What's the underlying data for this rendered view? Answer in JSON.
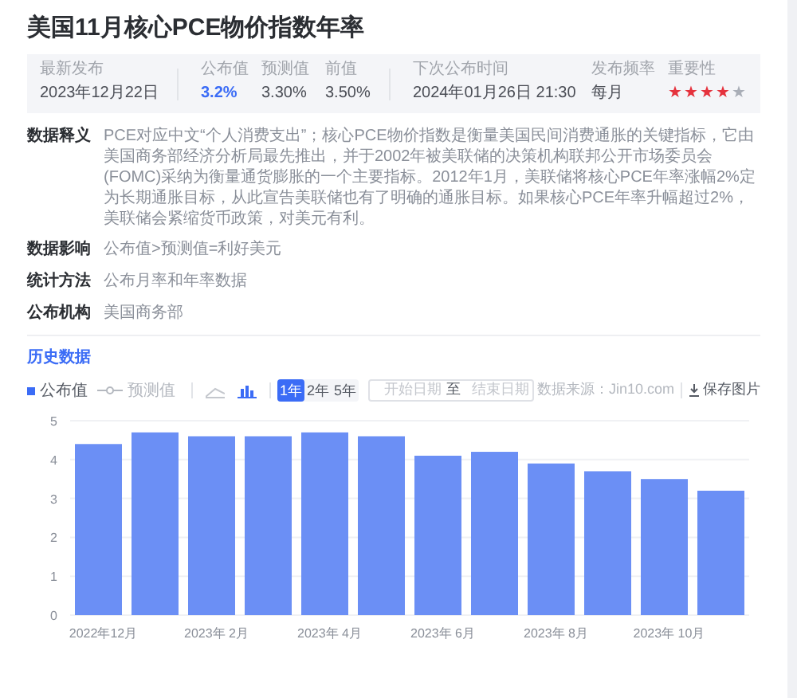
{
  "title": "美国11月核心PCE物价指数年率",
  "summary": [
    {
      "label": "最新发布",
      "value": "2023年12月22日",
      "kind": "text",
      "highlight": false
    },
    {
      "label": "公布值",
      "value": "3.2%",
      "kind": "text",
      "highlight": true
    },
    {
      "label": "预测值",
      "value": "3.30%",
      "kind": "text",
      "highlight": false
    },
    {
      "label": "前值",
      "value": "3.50%",
      "kind": "text",
      "highlight": false
    },
    {
      "label": "下次公布时间",
      "value": "2024年01月26日 21:30",
      "kind": "text",
      "highlight": false
    },
    {
      "label": "发布频率",
      "value": "每月",
      "kind": "text",
      "highlight": false
    },
    {
      "label": "重要性",
      "stars": 4,
      "kind": "stars"
    }
  ],
  "details": [
    {
      "label": "数据释义",
      "text": "PCE对应中文“个人消费支出”；核心PCE物价指数是衡量美国民间消费通胀的关键指标，它由美国商务部经济分析局最先推出，并于2002年被美联储的决策机构联邦公开市场委员会(FOMC)采纳为衡量通货膨胀的一个主要指标。2012年1月，美联储将核心PCE年率涨幅2%定为长期通胀目标，从此宣告美联储也有了明确的通胀目标。如果核心PCE年率升幅超过2%，美联储会紧缩货币政策，对美元有利。"
    },
    {
      "label": "数据影响",
      "text": "公布值>预测值=利好美元"
    },
    {
      "label": "统计方法",
      "text": "公布月率和年率数据"
    },
    {
      "label": "公布机构",
      "text": "美国商务部"
    }
  ],
  "history": {
    "title": "历史数据",
    "legend": [
      {
        "label": "公布值",
        "kind": "square",
        "selected": true
      },
      {
        "label": "预测值",
        "kind": "line",
        "selected": false
      }
    ],
    "chart_types": [
      {
        "kind": "line",
        "selected": false
      },
      {
        "kind": "bar",
        "selected": true
      }
    ],
    "ranges": [
      {
        "label": "1年",
        "selected": true
      },
      {
        "label": "2年",
        "selected": false
      },
      {
        "label": "5年",
        "selected": false
      }
    ],
    "start_placeholder": "开始日期",
    "separator": "至",
    "end_placeholder": "结束日期",
    "source": "数据来源：Jin10.com",
    "save": "保存图片",
    "chart_data": {
      "type": "bar",
      "categories": [
        "2022年12月",
        null,
        "2023年 2月",
        null,
        "2023年 4月",
        null,
        "2023年 6月",
        null,
        "2023年 8月",
        null,
        "2023年 10月",
        null
      ],
      "series": [
        {
          "color": "#6b8ff5",
          "values": [
            4.4,
            4.7,
            4.6,
            4.6,
            4.7,
            4.6,
            4.1,
            4.2,
            3.9,
            3.7,
            3.5,
            3.2
          ]
        }
      ],
      "ylim": [
        0,
        5
      ],
      "grid": true,
      "yticks": [
        0,
        1,
        2,
        3,
        4,
        5
      ]
    }
  }
}
